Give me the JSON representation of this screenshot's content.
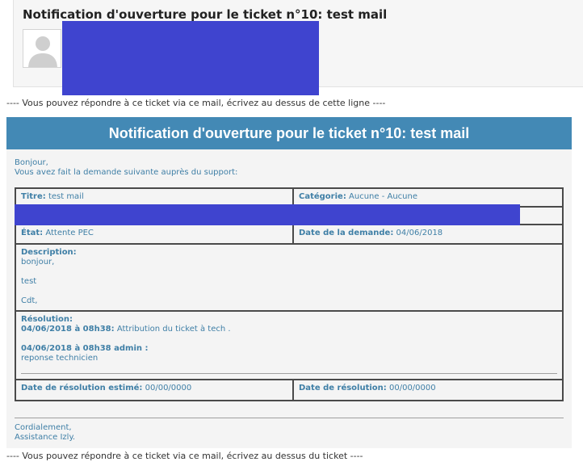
{
  "mail": {
    "subject": "Notification d'ouverture pour le ticket n°10: test mail",
    "reply_top": "---- Vous pouvez répondre à ce ticket via ce mail, écrivez au dessus de cette ligne ----",
    "reply_bottom": "---- Vous pouvez répondre à ce ticket via ce mail, écrivez au dessus du ticket ----"
  },
  "card": {
    "banner_title": "Notification d'ouverture pour le ticket n°10: test mail",
    "greeting_1": "Bonjour,",
    "greeting_2": "Vous avez fait la demande suivante auprès du support:",
    "titre_label": "Titre:",
    "titre_value": "test mail",
    "categorie_label": "Catégorie:",
    "categorie_value": "Aucune - Aucune",
    "etat_label": "État:",
    "etat_value": "Attente PEC",
    "date_demande_label": "Date de la demande:",
    "date_demande_value": "04/06/2018",
    "description_label": "Description:",
    "description_line_1": "bonjour,",
    "description_line_2": "test",
    "description_line_3": "Cdt,",
    "resolution_label": "Résolution:",
    "resolution_entry_1_when": "04/06/2018 à 08h38:",
    "resolution_entry_1_text": "Attribution du ticket à tech .",
    "resolution_entry_2_when": "04/06/2018 à 08h38 admin :",
    "resolution_entry_2_text": "reponse technicien",
    "date_estime_label": "Date de résolution estimé:",
    "date_estime_value": "00/00/0000",
    "date_resolution_label": "Date de résolution:",
    "date_resolution_value": "00/00/0000",
    "closing_1": "Cordialement,",
    "closing_2": "Assistance Izly."
  },
  "colors": {
    "banner": "#4389b5",
    "text_blue": "#3f7fa6",
    "redaction": "#3f44cf"
  },
  "icons": {
    "avatar": "default-user-silhouette-icon"
  }
}
